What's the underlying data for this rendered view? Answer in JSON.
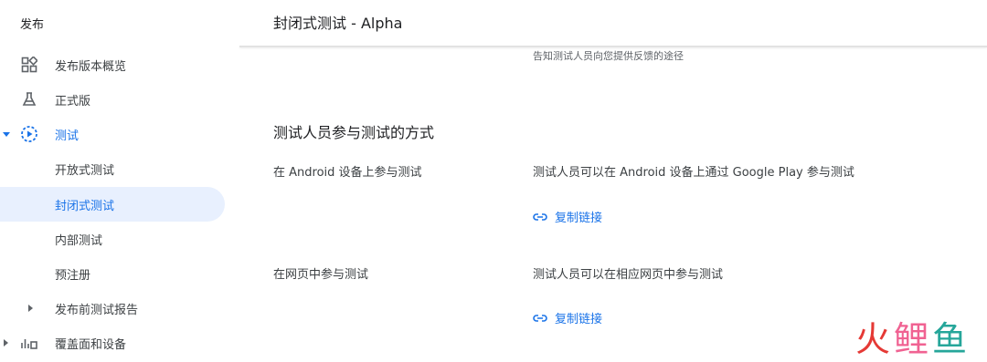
{
  "sidebar": {
    "header": "发布",
    "items": [
      {
        "label": "发布版本概览",
        "icon": "dashboard-icon"
      },
      {
        "label": "正式版",
        "icon": "flask-icon"
      },
      {
        "label": "测试",
        "icon": "play-circle-icon"
      },
      {
        "label": "开放式测试"
      },
      {
        "label": "封闭式测试"
      },
      {
        "label": "内部测试"
      },
      {
        "label": "预注册"
      },
      {
        "label": "发布前测试报告"
      },
      {
        "label": "覆盖面和设备",
        "icon": "bar-chart-icon"
      }
    ],
    "accent": "#1a73e8",
    "active_bg": "#e8f0fe"
  },
  "main": {
    "title": "封闭式测试 - Alpha",
    "hint": "告知测试人员向您提供反馈的途径",
    "section_title": "测试人员参与测试的方式",
    "rows": [
      {
        "label": "在 Android 设备上参与测试",
        "description": "测试人员可以在 Android 设备上通过 Google Play 参与测试",
        "link": "复制链接"
      },
      {
        "label": "在网页中参与测试",
        "description": "测试人员可以在相应网页中参与测试",
        "link": "复制链接"
      }
    ]
  },
  "watermark": {
    "c1": "火",
    "c2": "鲤",
    "c3": "鱼"
  }
}
